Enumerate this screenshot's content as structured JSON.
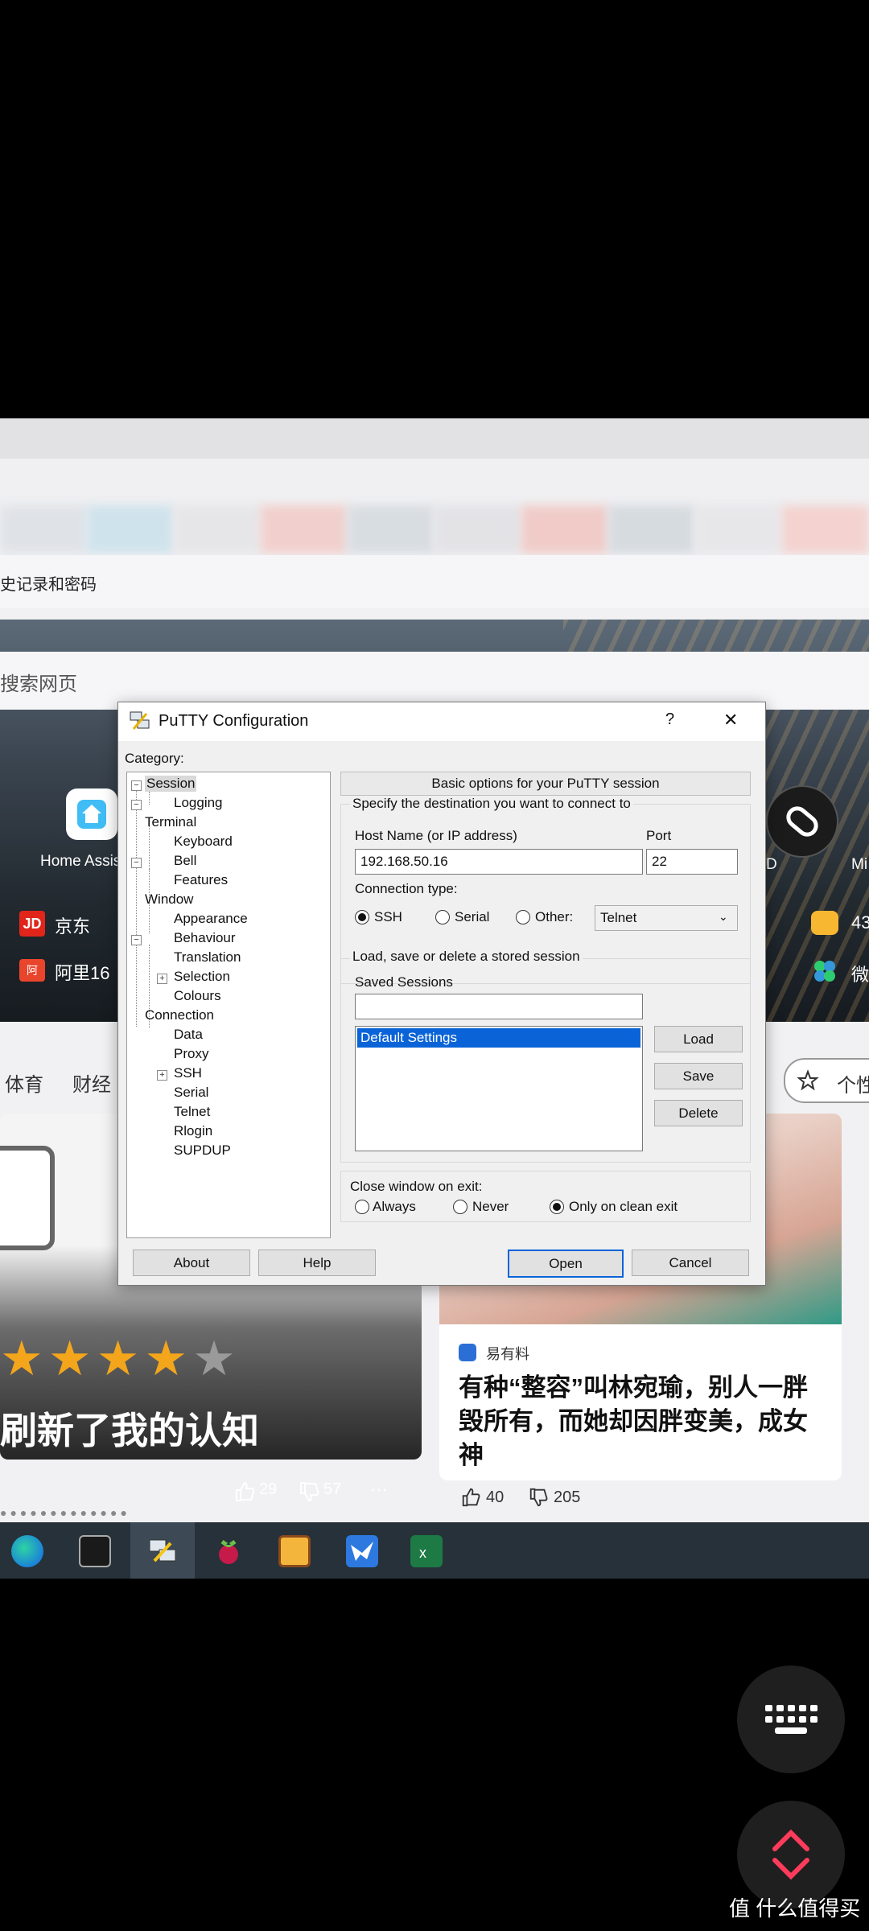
{
  "background": {
    "history_text": "史记录和密码",
    "search_placeholder": "搜索网页",
    "shortcuts": [
      {
        "label": "Home Assis",
        "icon": "home-assistant-icon"
      },
      {
        "label": "D"
      },
      {
        "label": "Mi"
      }
    ],
    "sites": [
      {
        "label": "京东",
        "badge": "JD"
      },
      {
        "label": "阿里16",
        "badge": "阿"
      },
      {
        "label": "43"
      },
      {
        "label": "微"
      }
    ],
    "nav_tabs": [
      "体育",
      "财经"
    ],
    "personalize_label": "个性",
    "card_left": {
      "headline": "刷新了我的认知",
      "likes": "29",
      "dislikes": "57",
      "more": "···"
    },
    "card_right": {
      "source": "易有料",
      "headline": "有种“整容”叫林宛瑜，别人一胖毁所有，而她却因胖变美，成女神",
      "likes": "40",
      "dislikes": "205"
    }
  },
  "putty": {
    "title": "PuTTY Configuration",
    "help_glyph": "?",
    "close_glyph": "✕",
    "category_label": "Category:",
    "tree": [
      {
        "label": "Session",
        "level": 0,
        "selected": true
      },
      {
        "label": "Logging",
        "level": 1
      },
      {
        "label": "Terminal",
        "level": 0
      },
      {
        "label": "Keyboard",
        "level": 1
      },
      {
        "label": "Bell",
        "level": 1
      },
      {
        "label": "Features",
        "level": 1
      },
      {
        "label": "Window",
        "level": 0
      },
      {
        "label": "Appearance",
        "level": 1
      },
      {
        "label": "Behaviour",
        "level": 1
      },
      {
        "label": "Translation",
        "level": 1
      },
      {
        "label": "Selection",
        "level": 1
      },
      {
        "label": "Colours",
        "level": 1
      },
      {
        "label": "Connection",
        "level": 0
      },
      {
        "label": "Data",
        "level": 1
      },
      {
        "label": "Proxy",
        "level": 1
      },
      {
        "label": "SSH",
        "level": 1
      },
      {
        "label": "Serial",
        "level": 1
      },
      {
        "label": "Telnet",
        "level": 1
      },
      {
        "label": "Rlogin",
        "level": 1
      },
      {
        "label": "SUPDUP",
        "level": 1
      }
    ],
    "header": "Basic options for your PuTTY session",
    "destination_label": "Specify the destination you want to connect to",
    "host_label": "Host Name (or IP address)",
    "host_value": "192.168.50.16",
    "port_label": "Port",
    "port_value": "22",
    "conn_type_label": "Connection type:",
    "conn_types": [
      "SSH",
      "Serial",
      "Other:"
    ],
    "other_select": "Telnet",
    "load_save_label": "Load, save or delete a stored session",
    "saved_sessions_label": "Saved Sessions",
    "saved_sessions_value": "",
    "sessions": [
      "Default Settings"
    ],
    "load": "Load",
    "save": "Save",
    "delete": "Delete",
    "close_label": "Close window on exit:",
    "close_opts": [
      "Always",
      "Never",
      "Only on clean exit"
    ],
    "about": "About",
    "help": "Help",
    "open": "Open",
    "cancel": "Cancel"
  },
  "watermark": "值 什么值得买"
}
